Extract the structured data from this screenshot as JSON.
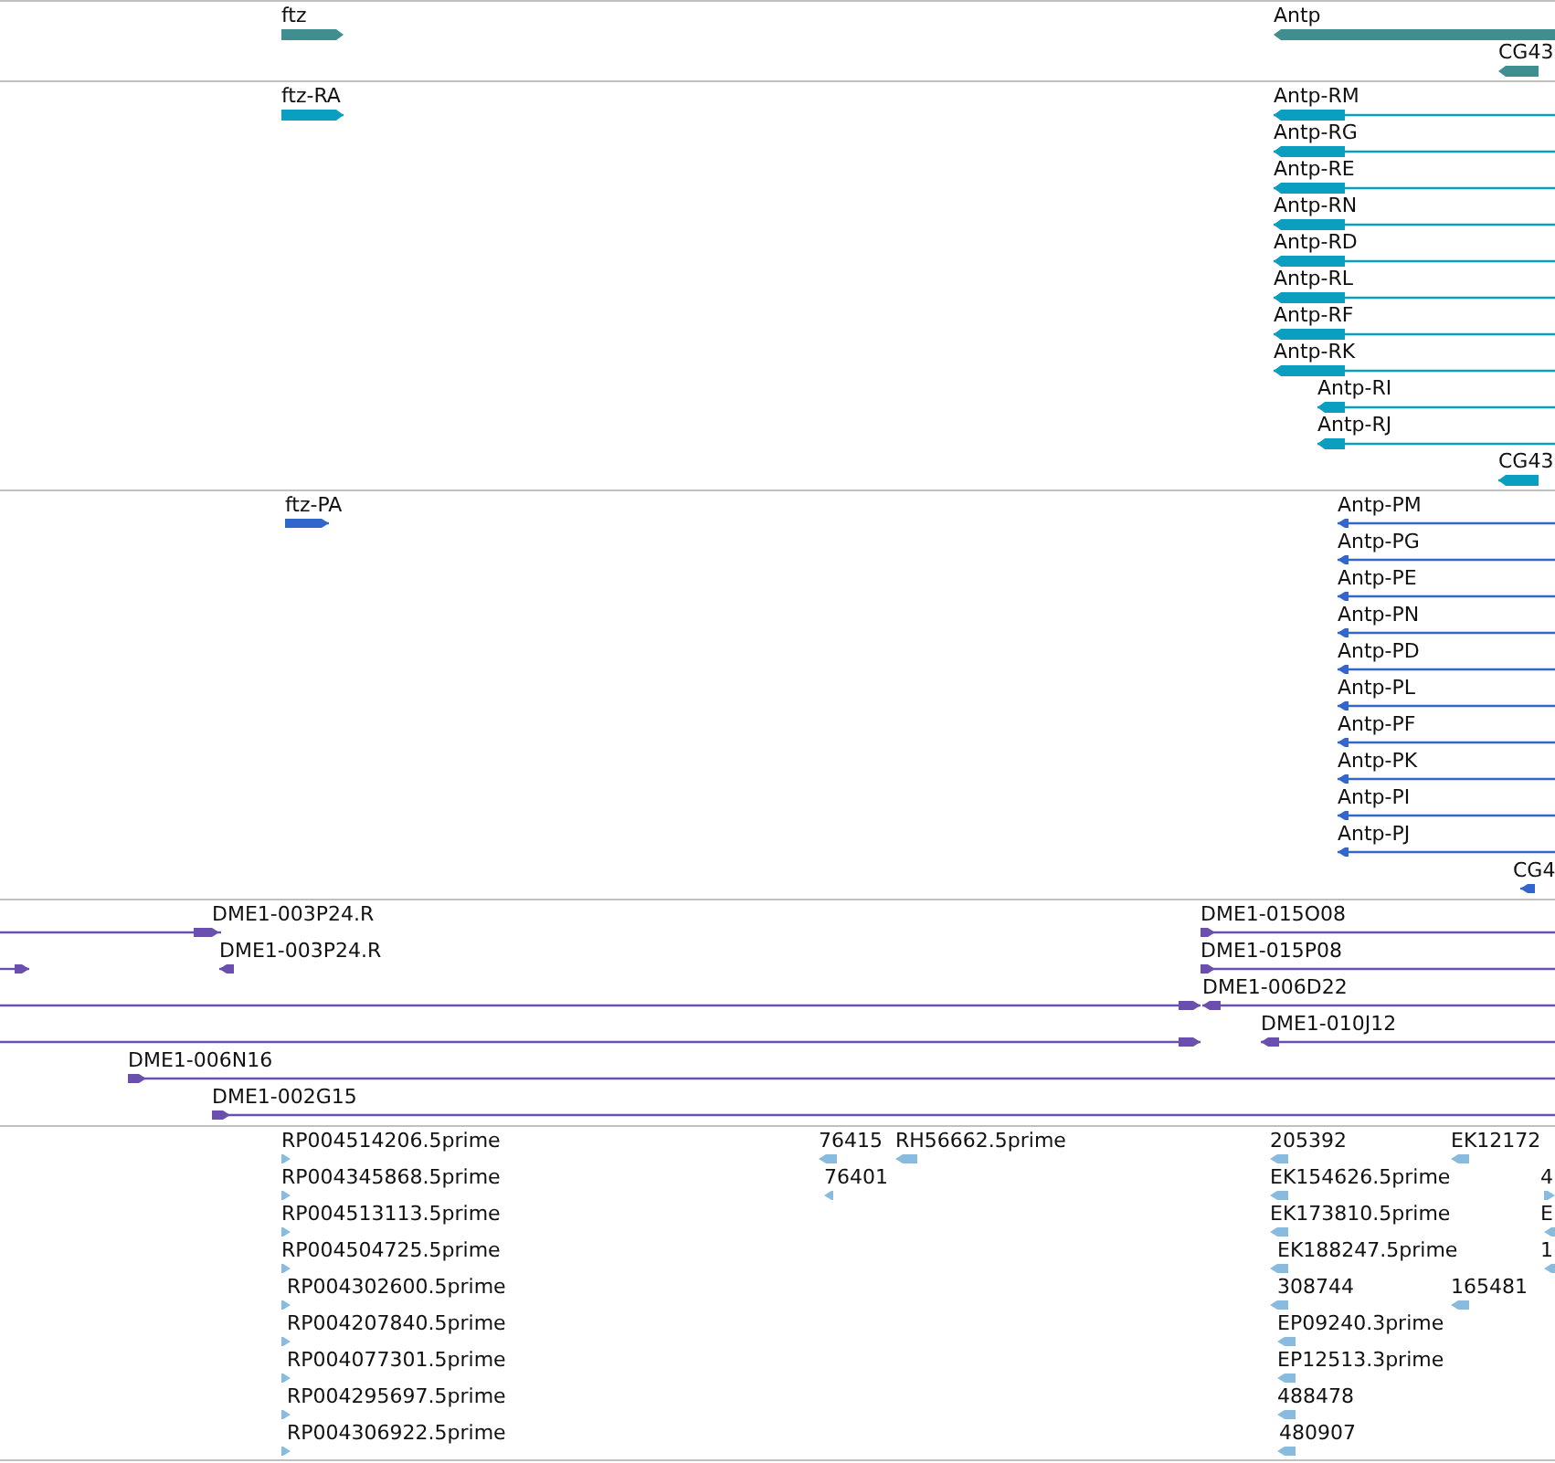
{
  "tracks": [
    {
      "kind": "gene",
      "color": "#3f8f91",
      "features": [
        {
          "label": "ftz",
          "reverse": false
        },
        {
          "label": "Antp",
          "reverse": true
        },
        {
          "label": "CG43",
          "reverse": true
        }
      ]
    },
    {
      "kind": "transcript",
      "color": "#0a9fc0",
      "features": [
        {
          "label": "ftz-RA",
          "reverse": false
        },
        {
          "label": "Antp-RM",
          "reverse": true
        },
        {
          "label": "Antp-RG",
          "reverse": true
        },
        {
          "label": "Antp-RE",
          "reverse": true
        },
        {
          "label": "Antp-RN",
          "reverse": true
        },
        {
          "label": "Antp-RD",
          "reverse": true
        },
        {
          "label": "Antp-RL",
          "reverse": true
        },
        {
          "label": "Antp-RF",
          "reverse": true
        },
        {
          "label": "Antp-RK",
          "reverse": true
        },
        {
          "label": "Antp-RI",
          "reverse": true
        },
        {
          "label": "Antp-RJ",
          "reverse": true
        },
        {
          "label": "CG43",
          "reverse": true
        }
      ]
    },
    {
      "kind": "protein",
      "color": "#3366cc",
      "features": [
        {
          "label": "ftz-PA",
          "reverse": false
        },
        {
          "label": "Antp-PM",
          "reverse": true
        },
        {
          "label": "Antp-PG",
          "reverse": true
        },
        {
          "label": "Antp-PE",
          "reverse": true
        },
        {
          "label": "Antp-PN",
          "reverse": true
        },
        {
          "label": "Antp-PD",
          "reverse": true
        },
        {
          "label": "Antp-PL",
          "reverse": true
        },
        {
          "label": "Antp-PF",
          "reverse": true
        },
        {
          "label": "Antp-PK",
          "reverse": true
        },
        {
          "label": "Antp-PI",
          "reverse": true
        },
        {
          "label": "Antp-PJ",
          "reverse": true
        },
        {
          "label": "CG4",
          "reverse": true
        }
      ]
    },
    {
      "kind": "clone",
      "color": "#6a4fae",
      "features": [
        {
          "label": "DME1-003P24.R",
          "reverse": false
        },
        {
          "label": "DME1-015O08",
          "reverse": false
        },
        {
          "reverse": false
        },
        {
          "label": "DME1-003P24.R",
          "reverse": true
        },
        {
          "label": "DME1-015P08",
          "reverse": false
        },
        {
          "reverse": false
        },
        {
          "label": "DME1-006D22",
          "reverse": true
        },
        {
          "reverse": false
        },
        {
          "label": "DME1-010J12",
          "reverse": true
        },
        {
          "label": "DME1-006N16",
          "reverse": false
        },
        {
          "label": "DME1-002G15",
          "reverse": false
        }
      ]
    },
    {
      "kind": "est",
      "color": "#88bbdd",
      "features": [
        {
          "label": "RP004514206.5prime",
          "reverse": false
        },
        {
          "label": "76415",
          "reverse": true
        },
        {
          "label": "RH56662.5prime",
          "reverse": true
        },
        {
          "label": "205392",
          "reverse": true
        },
        {
          "label": "EK12172",
          "reverse": true
        },
        {
          "label": "RP004345868.5prime",
          "reverse": false
        },
        {
          "label": "76401",
          "reverse": true
        },
        {
          "label": "EK154626.5prime",
          "reverse": true
        },
        {
          "label": "4",
          "reverse": false
        },
        {
          "label": "RP004513113.5prime",
          "reverse": false
        },
        {
          "label": "EK173810.5prime",
          "reverse": true
        },
        {
          "label": "E",
          "reverse": true
        },
        {
          "label": "RP004504725.5prime",
          "reverse": false
        },
        {
          "label": "EK188247.5prime",
          "reverse": true
        },
        {
          "label": "1",
          "reverse": true
        },
        {
          "label": "RP004302600.5prime",
          "reverse": false
        },
        {
          "label": "308744",
          "reverse": true
        },
        {
          "label": "165481",
          "reverse": true
        },
        {
          "label": "RP004207840.5prime",
          "reverse": false
        },
        {
          "label": "EP09240.3prime",
          "reverse": true
        },
        {
          "label": "RP004077301.5prime",
          "reverse": false
        },
        {
          "label": "EP12513.3prime",
          "reverse": true
        },
        {
          "label": "RP004295697.5prime",
          "reverse": false
        },
        {
          "label": "488478",
          "reverse": true
        },
        {
          "label": "RP004306922.5prime",
          "reverse": false
        },
        {
          "label": "480907",
          "reverse": true
        }
      ]
    }
  ]
}
